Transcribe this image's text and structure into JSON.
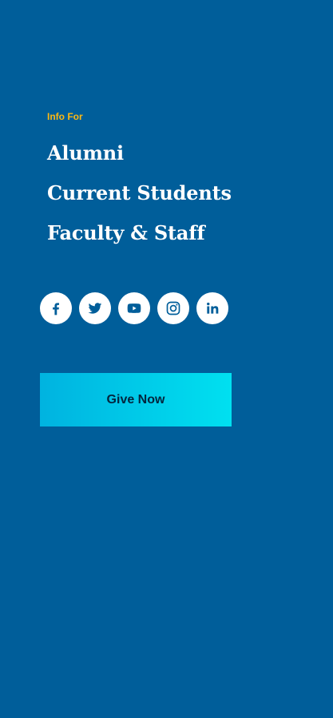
{
  "info_for": {
    "heading": "Info For",
    "links": [
      {
        "label": "Alumni"
      },
      {
        "label": "Current Students"
      },
      {
        "label": "Faculty & Staff"
      }
    ]
  },
  "social": [
    {
      "name": "facebook-icon",
      "label": "Facebook"
    },
    {
      "name": "twitter-icon",
      "label": "Twitter"
    },
    {
      "name": "youtube-icon",
      "label": "YouTube"
    },
    {
      "name": "instagram-icon",
      "label": "Instagram"
    },
    {
      "name": "linkedin-icon",
      "label": "LinkedIn"
    }
  ],
  "give": {
    "label": "Give Now"
  },
  "colors": {
    "background": "#005e9a",
    "heading_accent": "#fcb813",
    "link_text": "#ffffff",
    "icon_fg": "#005e9a",
    "give_gradient_start": "#00b3e0",
    "give_gradient_end": "#00e0f0",
    "give_text": "#04253d"
  }
}
